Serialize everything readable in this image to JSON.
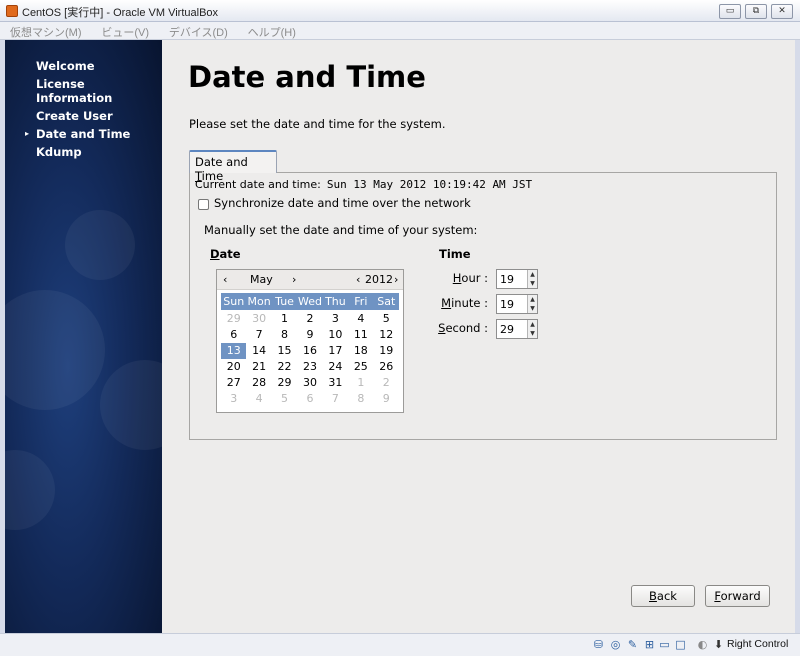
{
  "window": {
    "title": "CentOS [実行中] - Oracle VM VirtualBox",
    "minimize_glyph": "▭",
    "restore_glyph": "⧉",
    "close_glyph": "✕"
  },
  "menubar": {
    "items": [
      "仮想マシン(M)",
      "ビュー(V)",
      "デバイス(D)",
      "ヘルプ(H)"
    ]
  },
  "sidebar": {
    "items": [
      {
        "label": "Welcome",
        "active": false
      },
      {
        "label": "License Information",
        "active": false
      },
      {
        "label": "Create User",
        "active": false
      },
      {
        "label": "Date and Time",
        "active": true
      },
      {
        "label": "Kdump",
        "active": false
      }
    ],
    "active_marker": "▸"
  },
  "page": {
    "title": "Date and Time",
    "subtitle": "Please set the date and time for the system.",
    "tab_label_pre": "Date and ",
    "tab_label_mnemonic": "T",
    "tab_label_post": "ime",
    "current_label": "Current date and time:",
    "current_value": "Sun 13 May 2012 10:19:42 AM JST",
    "sync_label": "Synchronize date and time over the network",
    "sync_checked": false,
    "manual_label": "Manually set the date and time of your system:"
  },
  "date": {
    "heading_mnemonic": "D",
    "heading_rest": "ate",
    "prev_month": "‹",
    "month": "May",
    "next_month": "›",
    "prev_year": "‹",
    "year": "2012",
    "next_year": "›",
    "weekdays": [
      "Sun",
      "Mon",
      "Tue",
      "Wed",
      "Thu",
      "Fri",
      "Sat"
    ],
    "weeks": [
      [
        "29",
        "30",
        "1",
        "2",
        "3",
        "4",
        "5"
      ],
      [
        "6",
        "7",
        "8",
        "9",
        "10",
        "11",
        "12"
      ],
      [
        "13",
        "14",
        "15",
        "16",
        "17",
        "18",
        "19"
      ],
      [
        "20",
        "21",
        "22",
        "23",
        "24",
        "25",
        "26"
      ],
      [
        "27",
        "28",
        "29",
        "30",
        "31",
        "1",
        "2"
      ],
      [
        "3",
        "4",
        "5",
        "6",
        "7",
        "8",
        "9"
      ]
    ],
    "selected_day": "13"
  },
  "time": {
    "heading": "Time",
    "hour_mnemonic": "H",
    "hour_rest": "our :",
    "hour": "19",
    "minute_mnemonic": "M",
    "minute_rest": "inute :",
    "minute": "19",
    "second_mnemonic": "S",
    "second_rest": "econd :",
    "second": "29",
    "up_glyph": "▲",
    "down_glyph": "▼"
  },
  "buttons": {
    "back_mnemonic": "B",
    "back_rest": "ack",
    "forward_mnemonic": "F",
    "forward_rest": "orward"
  },
  "statusbar": {
    "icons": [
      "hard-disk-icon",
      "optical-drive-icon",
      "usb-icon",
      "network-icon",
      "shared-folders-icon",
      "display-icon",
      "mouse-integration-icon",
      "host-key-icon"
    ],
    "host_key_label": "Right Control"
  },
  "colors": {
    "accent": "#6f93c3",
    "sidebar": "#132a5a",
    "background": "#edeceb"
  }
}
